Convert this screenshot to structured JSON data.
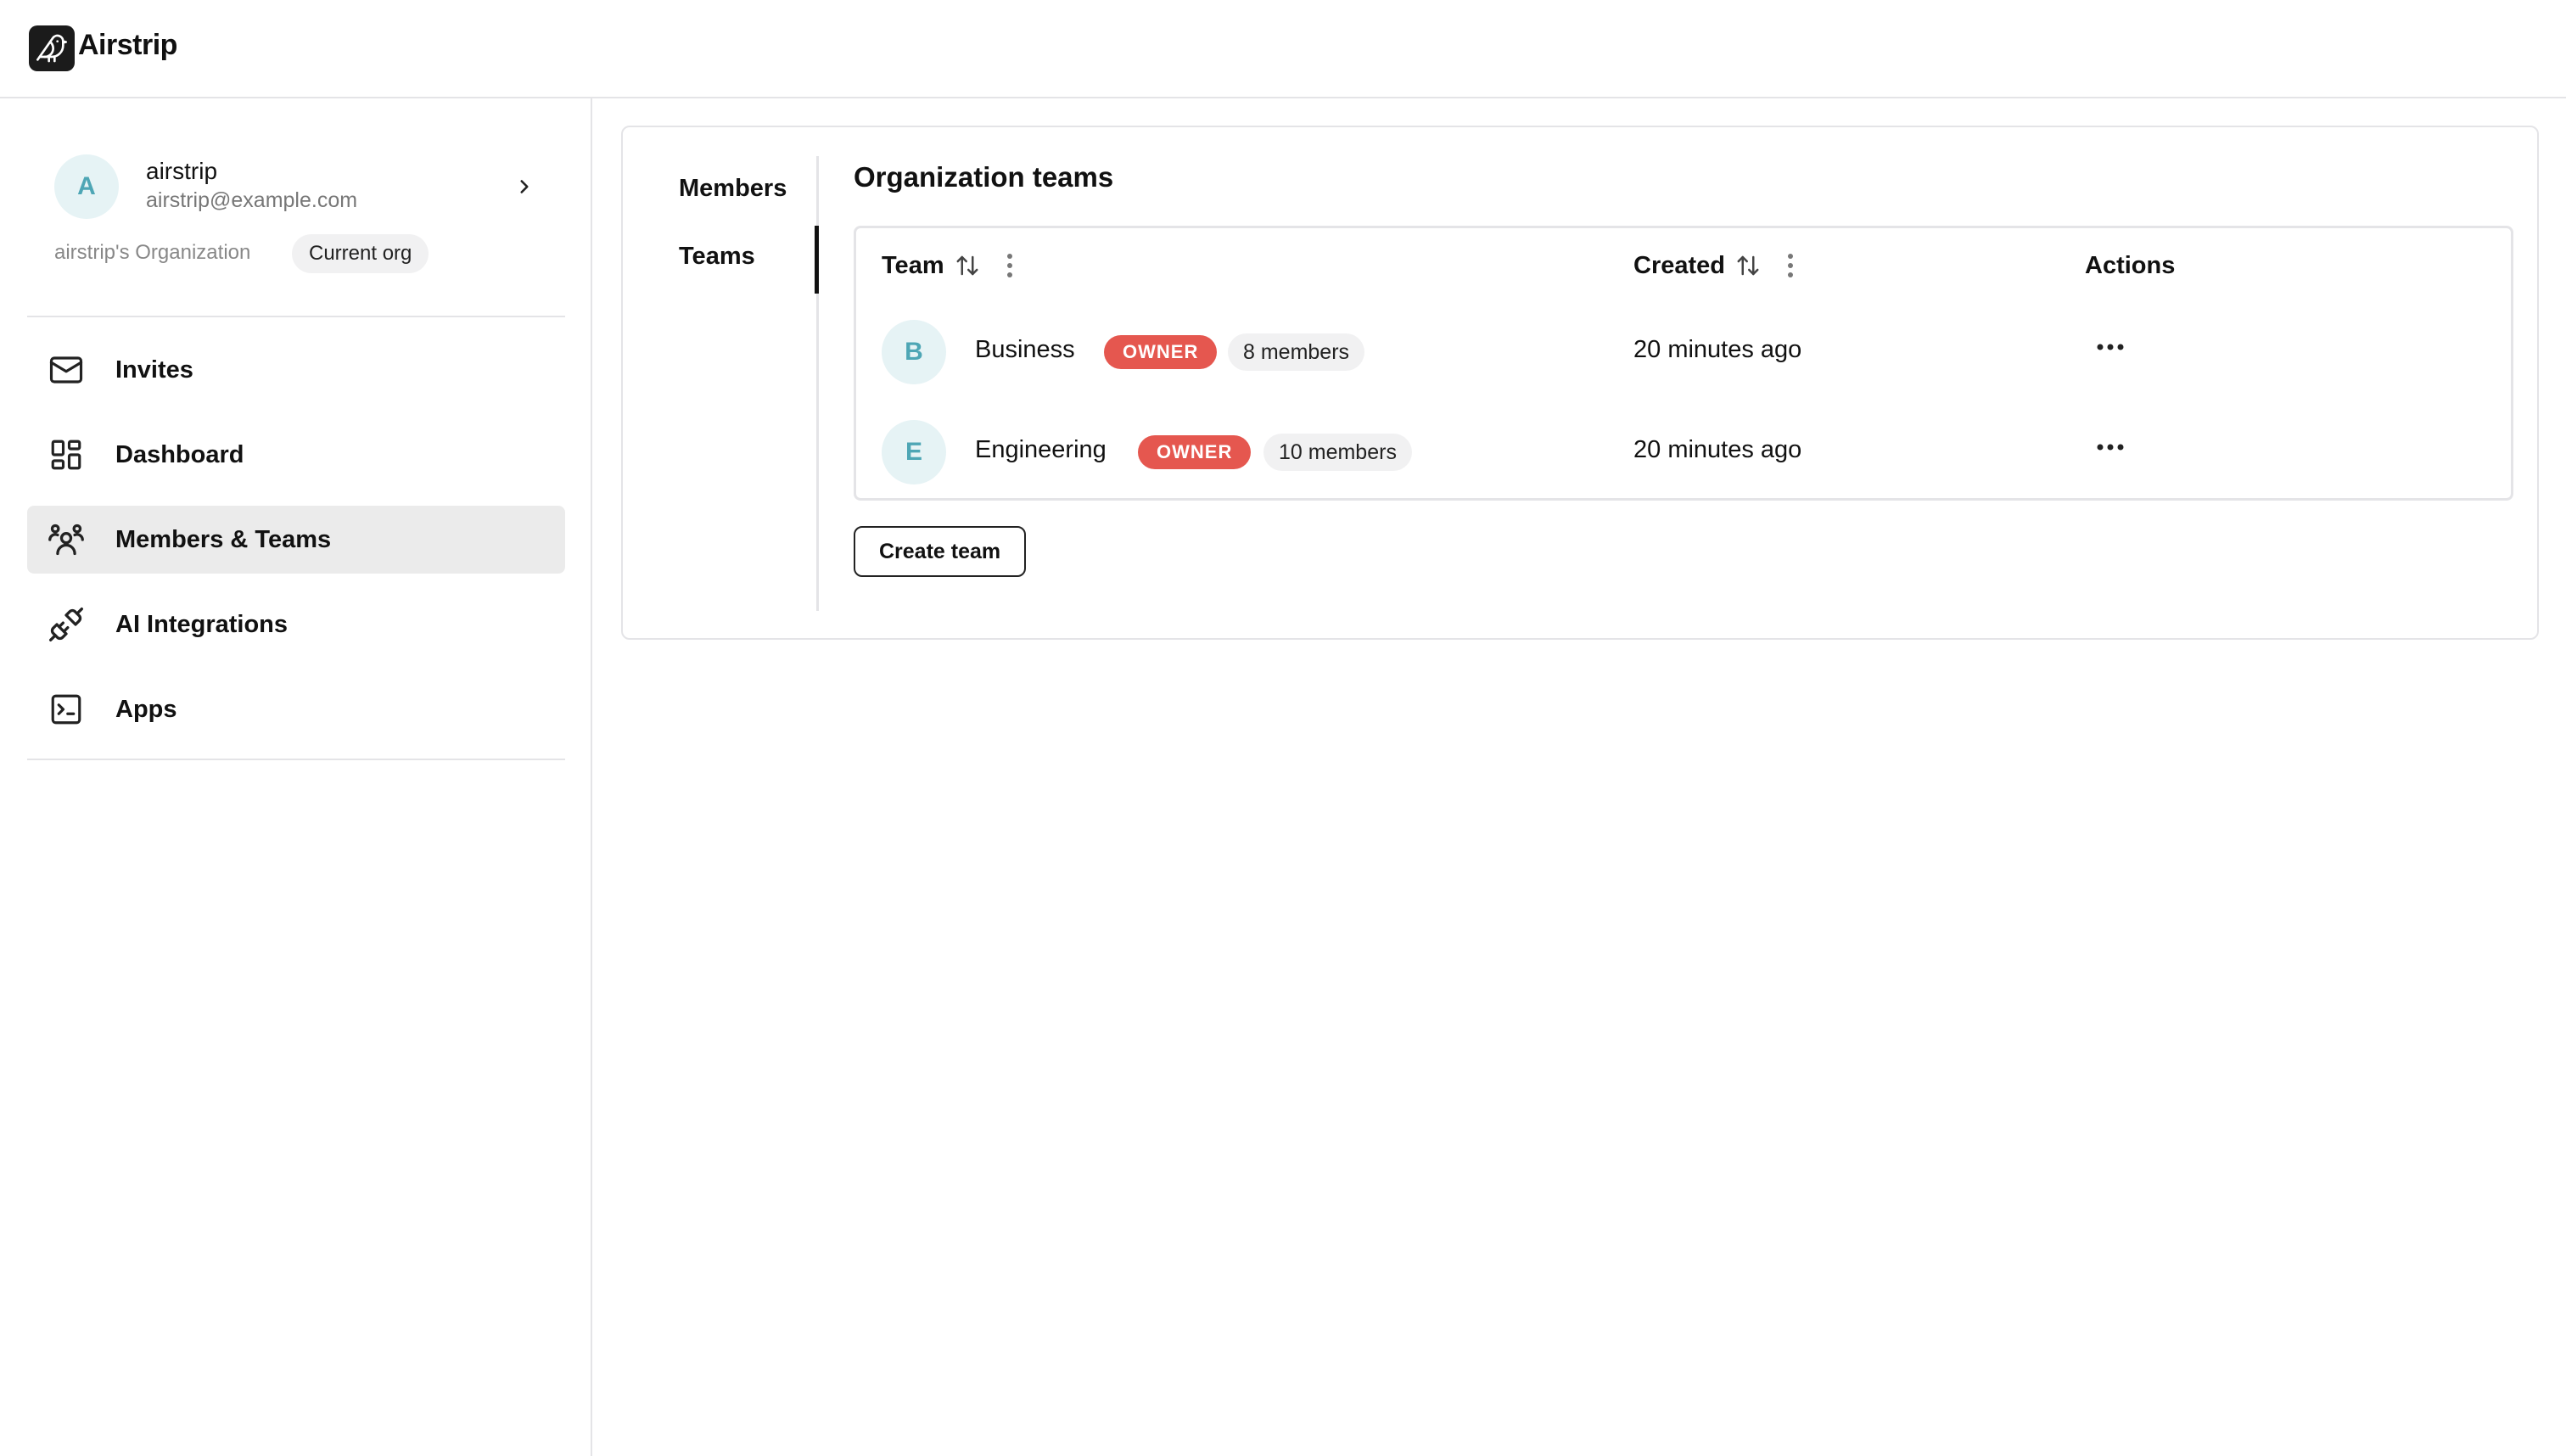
{
  "app": {
    "title": "Airstrip",
    "logo_icon": "bird-icon"
  },
  "account": {
    "avatar_letter": "A",
    "name": "airstrip",
    "email": "airstrip@example.com",
    "org_name": "airstrip's Organization",
    "org_badge": "Current org"
  },
  "sidebar": {
    "items": [
      {
        "label": "Invites",
        "icon": "mail-icon",
        "active": false
      },
      {
        "label": "Dashboard",
        "icon": "dashboard-icon",
        "active": false
      },
      {
        "label": "Members & Teams",
        "icon": "users-icon",
        "active": true
      },
      {
        "label": "AI Integrations",
        "icon": "plug-icon",
        "active": false
      },
      {
        "label": "Apps",
        "icon": "terminal-icon",
        "active": false
      }
    ]
  },
  "subnav": {
    "items": [
      {
        "label": "Members",
        "active": false
      },
      {
        "label": "Teams",
        "active": true
      }
    ]
  },
  "teams": {
    "title": "Organization teams",
    "columns": {
      "team": "Team",
      "created": "Created",
      "actions": "Actions"
    },
    "rows": [
      {
        "avatar": "B",
        "name": "Business",
        "role": "OWNER",
        "members": "8 members",
        "created": "20 minutes ago"
      },
      {
        "avatar": "E",
        "name": "Engineering",
        "role": "OWNER",
        "members": "10 members",
        "created": "20 minutes ago"
      }
    ],
    "create_label": "Create team"
  },
  "colors": {
    "owner_badge": "#e5574f",
    "avatar_bg": "#e6f3f5",
    "avatar_text": "#4ea6b5",
    "active_nav_bg": "#ebebeb"
  }
}
